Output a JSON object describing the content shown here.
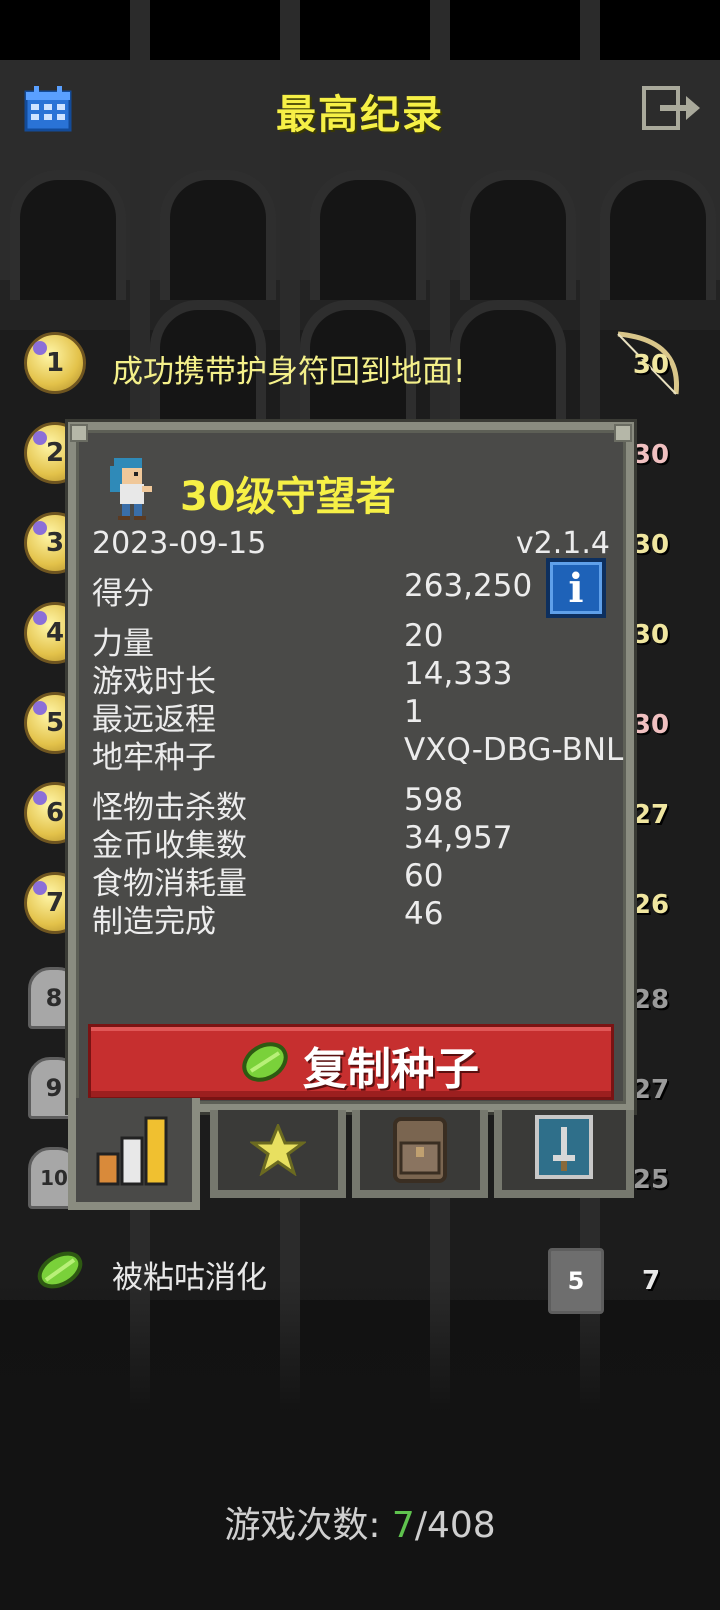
{
  "header": {
    "title": "最高纪录"
  },
  "rankings": [
    {
      "rank": "1",
      "description": "成功携带护身符回到地面!",
      "level": "30"
    },
    {
      "rank": "2",
      "level": "30"
    },
    {
      "rank": "3",
      "level": "30"
    },
    {
      "rank": "4",
      "level": "30"
    },
    {
      "rank": "5",
      "level": "30"
    },
    {
      "rank": "6",
      "level": "27"
    },
    {
      "rank": "7",
      "level": "26"
    },
    {
      "rank": "8",
      "level": "28"
    },
    {
      "rank": "9",
      "level": "27"
    },
    {
      "rank": "10",
      "level": "25"
    }
  ],
  "dialog": {
    "title": "30级守望者",
    "date": "2023-09-15",
    "version": "v2.1.4",
    "stats_group1": [
      {
        "label": "得分",
        "value": "263,250"
      }
    ],
    "stats_group2": [
      {
        "label": "力量",
        "value": "20"
      },
      {
        "label": "游戏时长",
        "value": "14,333"
      },
      {
        "label": "最远返程",
        "value": "1"
      },
      {
        "label": "地牢种子",
        "value": "VXQ-DBG-BNL"
      }
    ],
    "stats_group3": [
      {
        "label": "怪物击杀数",
        "value": "598"
      },
      {
        "label": "金币收集数",
        "value": "34,957"
      },
      {
        "label": "食物消耗量",
        "value": "60"
      },
      {
        "label": "制造完成",
        "value": "46"
      }
    ],
    "copy_seed_label": "复制种子",
    "info_label": "i",
    "tabs": [
      {
        "name": "stats-tab",
        "active": true
      },
      {
        "name": "badges-tab",
        "active": false
      },
      {
        "name": "items-tab",
        "active": false
      },
      {
        "name": "challenges-tab",
        "active": false
      }
    ]
  },
  "latest_game": {
    "description": "被粘咕消化",
    "depth": "5",
    "level": "7"
  },
  "footer": {
    "label": "游戏次数: ",
    "current": "7",
    "total": "/408"
  },
  "colors": {
    "title_yellow": "#f6f046",
    "button_red": "#c62f2f",
    "count_green": "#5fc34e",
    "info_blue": "#1e62b8"
  }
}
